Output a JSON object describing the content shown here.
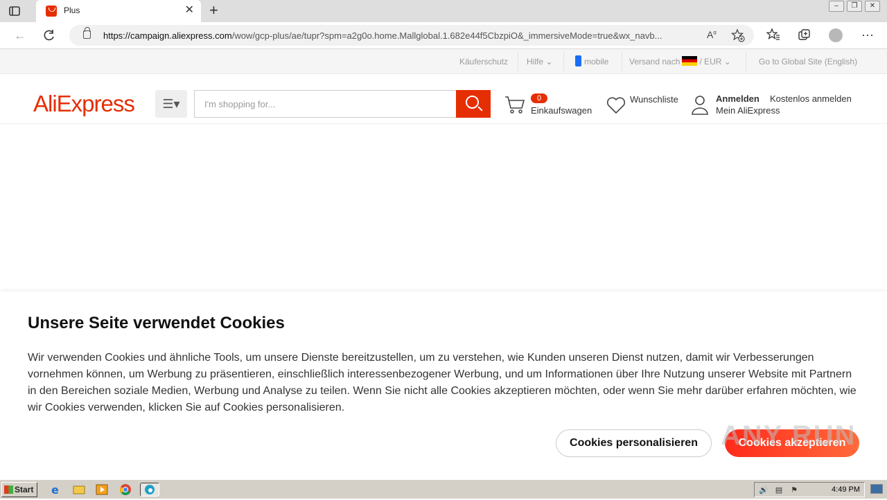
{
  "browser": {
    "tab_title": "Plus",
    "url_host": "https://campaign.aliexpress.com",
    "url_path": "/wow/gcp-plus/ae/tupr?spm=a2g0o.home.Mallglobal.1.682e44f5CbzpiO&_immersiveMode=true&wx_navb...",
    "icons": [
      "sidebar-icon",
      "close-icon",
      "plus-icon",
      "back-icon",
      "refresh-icon",
      "lock-icon",
      "read-aloud-icon",
      "add-favorite-icon",
      "favorites-icon",
      "collections-icon",
      "profile-icon",
      "more-icon"
    ]
  },
  "topbar": {
    "buyer_protection": "Käuferschutz",
    "help": "Hilfe",
    "mobile": "mobile",
    "ship_to": "Versand nach",
    "currency_sep": "/",
    "currency": "EUR",
    "global_site": "Go to Global Site (English)"
  },
  "header": {
    "logo": "AliExpress",
    "search_placeholder": "I'm shopping for...",
    "cart_count": "0",
    "cart_label": "Einkaufswagen",
    "wishlist_label": "Wunschliste",
    "login_label": "Anmelden",
    "register_label": "Kostenlos anmelden",
    "my_account_label": "Mein AliExpress"
  },
  "cookie": {
    "title": "Unsere Seite verwendet Cookies",
    "text": "Wir verwenden Cookies und ähnliche Tools, um unsere Dienste bereitzustellen, um zu verstehen, wie Kunden unseren Dienst nutzen, damit wir Verbesserungen vornehmen können, um Werbung zu präsentieren, einschließlich interessenbezogener Werbung, und um Informationen über Ihre Nutzung unserer Website mit Partnern in den Bereichen soziale Medien, Werbung und Analyse zu teilen. Wenn Sie nicht alle Cookies akzeptieren möchten, oder wenn Sie mehr darüber erfahren möchten, wie wir Cookies verwenden, klicken Sie auf Cookies personalisieren.",
    "customize_label": "Cookies personalisieren",
    "accept_label": "Cookies akzeptieren"
  },
  "watermark": "ANY RUN",
  "taskbar": {
    "start_label": "Start",
    "clock": "4:49 PM"
  },
  "colors": {
    "brand": "#e62e04",
    "accept_gradient_start": "#ff2a1b",
    "accept_gradient_end": "#ff6a3b"
  }
}
